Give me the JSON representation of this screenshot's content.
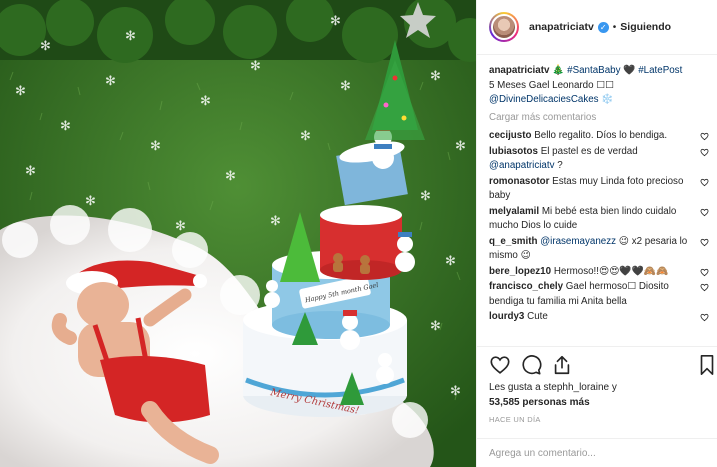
{
  "header": {
    "username": "anapatriciatv",
    "separator": "•",
    "follow_status": "Siguiendo"
  },
  "caption": {
    "username": "anapatriciatv",
    "tree_emoji": "🎄",
    "tag1": "#SantaBaby",
    "heart_emoji": "🖤",
    "tag2": "#LatePost",
    "line2": "5 Meses Gael Leonardo ☐☐",
    "mention": "@DivineDelicaciesCakes",
    "snow_emoji": "❄️"
  },
  "load_more": "Cargar más comentarios",
  "comments": [
    {
      "user": "cecijusto",
      "parts": [
        {
          "t": "Bello regalito. Díos lo bendiga."
        }
      ]
    },
    {
      "user": "lubiasotos",
      "parts": [
        {
          "t": "El pastel es de verdad "
        },
        {
          "t": "@anapatriciatv",
          "tag": true
        },
        {
          "t": " ?"
        }
      ]
    },
    {
      "user": "romonasotor",
      "parts": [
        {
          "t": "Estas muy Linda foto precioso baby"
        }
      ]
    },
    {
      "user": "melyalamil",
      "parts": [
        {
          "t": "Mi bebé esta bien lindo cuidalo mucho Dios lo cuide"
        }
      ]
    },
    {
      "user": "q_e_smith",
      "parts": [
        {
          "t": "@irasemayanezz",
          "tag": true
        },
        {
          "t": " 😉 x2 pesaria lo mismo 😉"
        }
      ]
    },
    {
      "user": "bere_lopez10",
      "parts": [
        {
          "t": "Hermoso!!😍😍🖤🖤🙈🙈"
        }
      ]
    },
    {
      "user": "francisco_chely",
      "parts": [
        {
          "t": "Gael hermoso☐ Diosito bendiga tu familia mi Anita bella"
        }
      ]
    },
    {
      "user": "lourdy3",
      "parts": [
        {
          "t": "Cute"
        }
      ]
    }
  ],
  "likes": {
    "line1": "Les gusta a stephh_loraine y",
    "count": "53,585",
    "count_suffix": " personas más"
  },
  "time_ago": "HACE UN DÍA",
  "add_comment": {
    "placeholder": "Agrega un comentario..."
  },
  "photo": {
    "topper_text": "Happy 5th month Gael",
    "base_text": "Merry Christmas!"
  },
  "icons": [
    "heart-icon",
    "comment-icon",
    "share-icon",
    "bookmark-icon",
    "verified-badge-icon"
  ],
  "colors": {
    "link": "#003569",
    "muted": "#999999",
    "text": "#262626",
    "verified": "#3897f0",
    "divider": "#efefef"
  }
}
